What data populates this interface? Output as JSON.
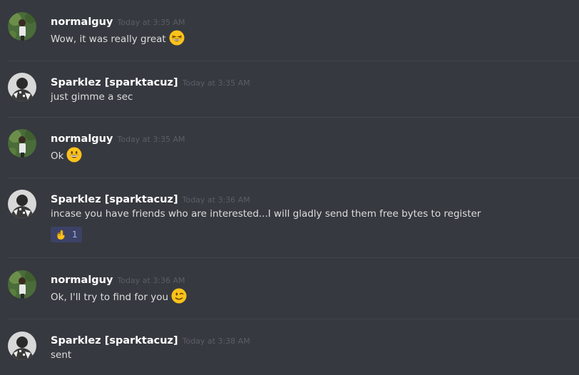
{
  "messages": [
    {
      "author": "normalguy",
      "timestamp": "Today at 3:35 AM",
      "text": "Wow, it was really great",
      "emoji": "grinning-squinting-face-emoji"
    },
    {
      "author": "Sparklez [sparktacuz]",
      "timestamp": "Today at 3:35 AM",
      "text": "just gimme a sec"
    },
    {
      "author": "normalguy",
      "timestamp": "Today at 3:35 AM",
      "text": "Ok",
      "emoji": "grinning-face-emoji"
    },
    {
      "author": "Sparklez [sparktacuz]",
      "timestamp": "Today at 3:36 AM",
      "text": "incase you have friends who are interested...I will gladly send them free bytes to register",
      "reaction": {
        "emoji": "ok-hand-emoji",
        "count": "1"
      }
    },
    {
      "author": "normalguy",
      "timestamp": "Today at 3:36 AM",
      "text": "Ok, I'll try to find for you",
      "emoji": "winking-face-emoji"
    },
    {
      "author": "Sparklez [sparktacuz]",
      "timestamp": "Today at 3:38 AM",
      "text": "sent"
    }
  ],
  "colors": {
    "background": "#36393f",
    "divider": "#42454b",
    "username": "#ffffff",
    "timestamp": "#5b5e64",
    "message_text": "#dcddde",
    "reaction_bg": "#3c4266",
    "reaction_count": "#9fb3e8"
  }
}
